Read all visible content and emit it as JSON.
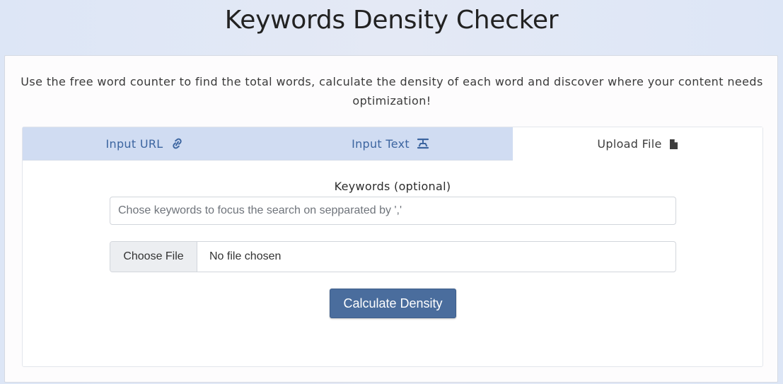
{
  "header": {
    "title": "Keywords Density Checker"
  },
  "intro": {
    "text": "Use the free word counter to find the total words, calculate the density of each word and discover where your content needs optimization!"
  },
  "tabs": [
    {
      "label": "Input URL",
      "icon": "link-icon",
      "active": false
    },
    {
      "label": "Input Text",
      "icon": "text-icon",
      "active": false
    },
    {
      "label": "Upload File",
      "icon": "file-icon",
      "active": true
    }
  ],
  "form": {
    "keywords_label": "Keywords (optional)",
    "keywords_placeholder": "Chose keywords to focus the search on sepparated by ','",
    "keywords_value": "",
    "choose_file_label": "Choose File",
    "file_status": "No file chosen",
    "submit_label": "Calculate Density"
  },
  "colors": {
    "active_tab_text": "#3d3d3d",
    "inactive_tab_text": "#3c65a0",
    "inactive_tab_bg": "#d0dcf2",
    "button_bg": "#4a6d9d"
  }
}
